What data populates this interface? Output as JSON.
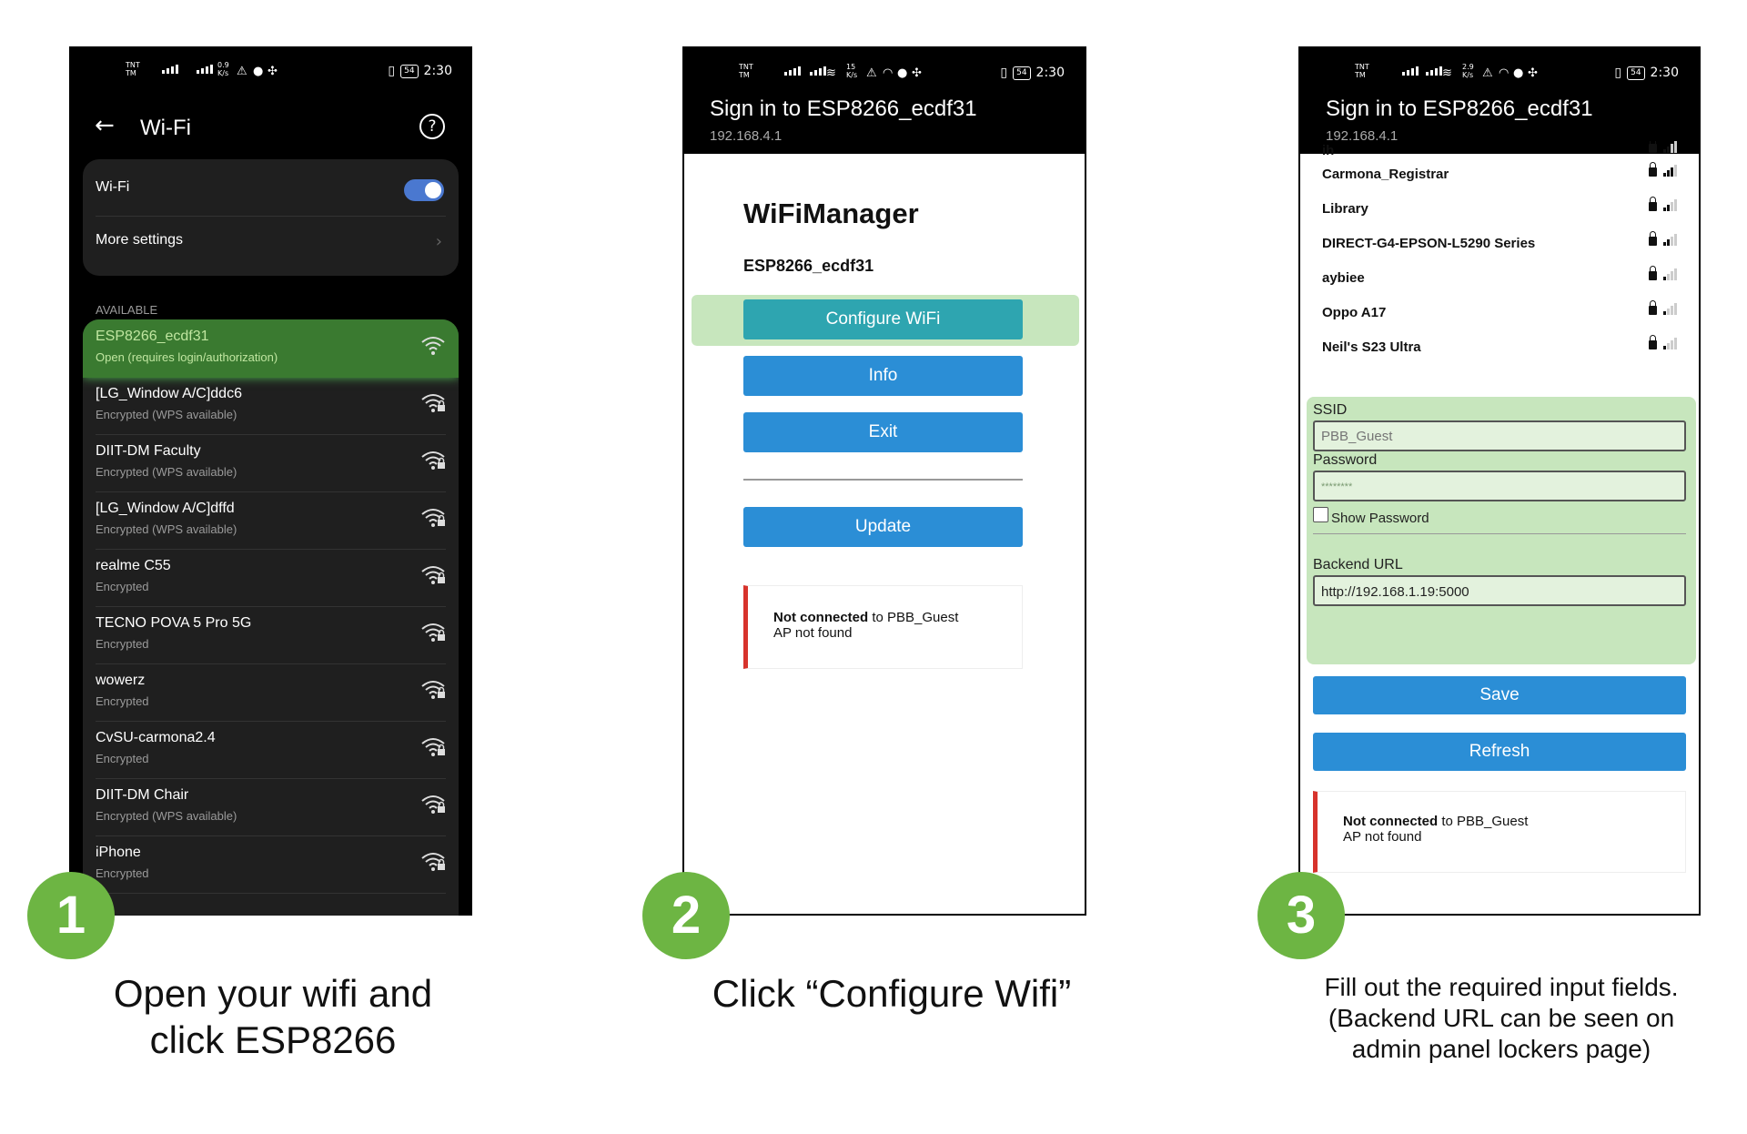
{
  "phone1": {
    "status": {
      "carrier": "TNT\nTM",
      "speed": "0.9\nK/s",
      "time": "2:30",
      "battery": "54"
    },
    "title": "Wi-Fi",
    "wifi_label": "Wi-Fi",
    "wifi_enabled": true,
    "more_settings": "More settings",
    "available_label": "AVAILABLE",
    "networks": [
      {
        "name": "ESP8266_ecdf31",
        "status": "Open (requires login/authorization)",
        "selected": true
      },
      {
        "name": "[LG_Window A/C]ddc6",
        "status": "Encrypted (WPS available)"
      },
      {
        "name": "DIIT-DM Faculty",
        "status": "Encrypted (WPS available)"
      },
      {
        "name": "[LG_Window A/C]dffd",
        "status": "Encrypted (WPS available)"
      },
      {
        "name": "realme C55",
        "status": "Encrypted"
      },
      {
        "name": "TECNO POVA 5 Pro 5G",
        "status": "Encrypted"
      },
      {
        "name": "wowerz",
        "status": "Encrypted"
      },
      {
        "name": "CvSU-carmona2.4",
        "status": "Encrypted"
      },
      {
        "name": "DIIT-DM Chair",
        "status": "Encrypted (WPS available)"
      },
      {
        "name": "iPhone",
        "status": "Encrypted"
      }
    ]
  },
  "phone2": {
    "status": {
      "carrier": "TNT\nTM",
      "speed": "15\nK/s",
      "time": "2:30",
      "battery": "54"
    },
    "header_title": "Sign in to ESP8266_ecdf31",
    "header_ip": "192.168.4.1",
    "app_title": "WiFiManager",
    "device": "ESP8266_ecdf31",
    "buttons": {
      "configure": "Configure WiFi",
      "info": "Info",
      "exit": "Exit",
      "update": "Update"
    },
    "message": {
      "strong": "Not connected",
      "rest": " to PBB_Guest",
      "line2": "AP not found"
    }
  },
  "phone3": {
    "status": {
      "carrier": "TNT\nTM",
      "speed": "2.9\nK/s",
      "time": "2:30",
      "battery": "54"
    },
    "header_title": "Sign in to ESP8266_ecdf31",
    "header_ip": "192.168.4.1",
    "partial_network": "ih",
    "networks": [
      {
        "name": "Carmona_Registrar",
        "bars": 3
      },
      {
        "name": "Library",
        "bars": 2
      },
      {
        "name": "DIRECT-G4-EPSON-L5290 Series",
        "bars": 2
      },
      {
        "name": "aybiee",
        "bars": 1
      },
      {
        "name": "Oppo A17",
        "bars": 1
      },
      {
        "name": "Neil's S23 Ultra",
        "bars": 1
      }
    ],
    "ssid_label": "SSID",
    "ssid_placeholder": "PBB_Guest",
    "password_label": "Password",
    "password_value": "********",
    "show_password": "Show Password",
    "backend_label": "Backend URL",
    "backend_value": "http://192.168.1.19:5000",
    "save": "Save",
    "refresh": "Refresh",
    "message": {
      "strong": "Not connected",
      "rest": " to PBB_Guest",
      "line2": "AP not found"
    }
  },
  "steps": [
    {
      "number": "1",
      "caption_line1": "Open your wifi and",
      "caption_line2": "click ESP8266"
    },
    {
      "number": "2",
      "caption_line1": "Click “Configure Wifi”"
    },
    {
      "number": "3",
      "caption_line1": "Fill out the required input fields.",
      "caption_line2": "(Backend URL can be seen on",
      "caption_line3": "admin panel lockers page)"
    }
  ],
  "colors": {
    "step_green": "#6db543",
    "button_blue": "#2b8ed6",
    "highlight_green": "#c7e6bd",
    "error_red": "#d7332c",
    "toggle_blue": "#4a78d0"
  }
}
